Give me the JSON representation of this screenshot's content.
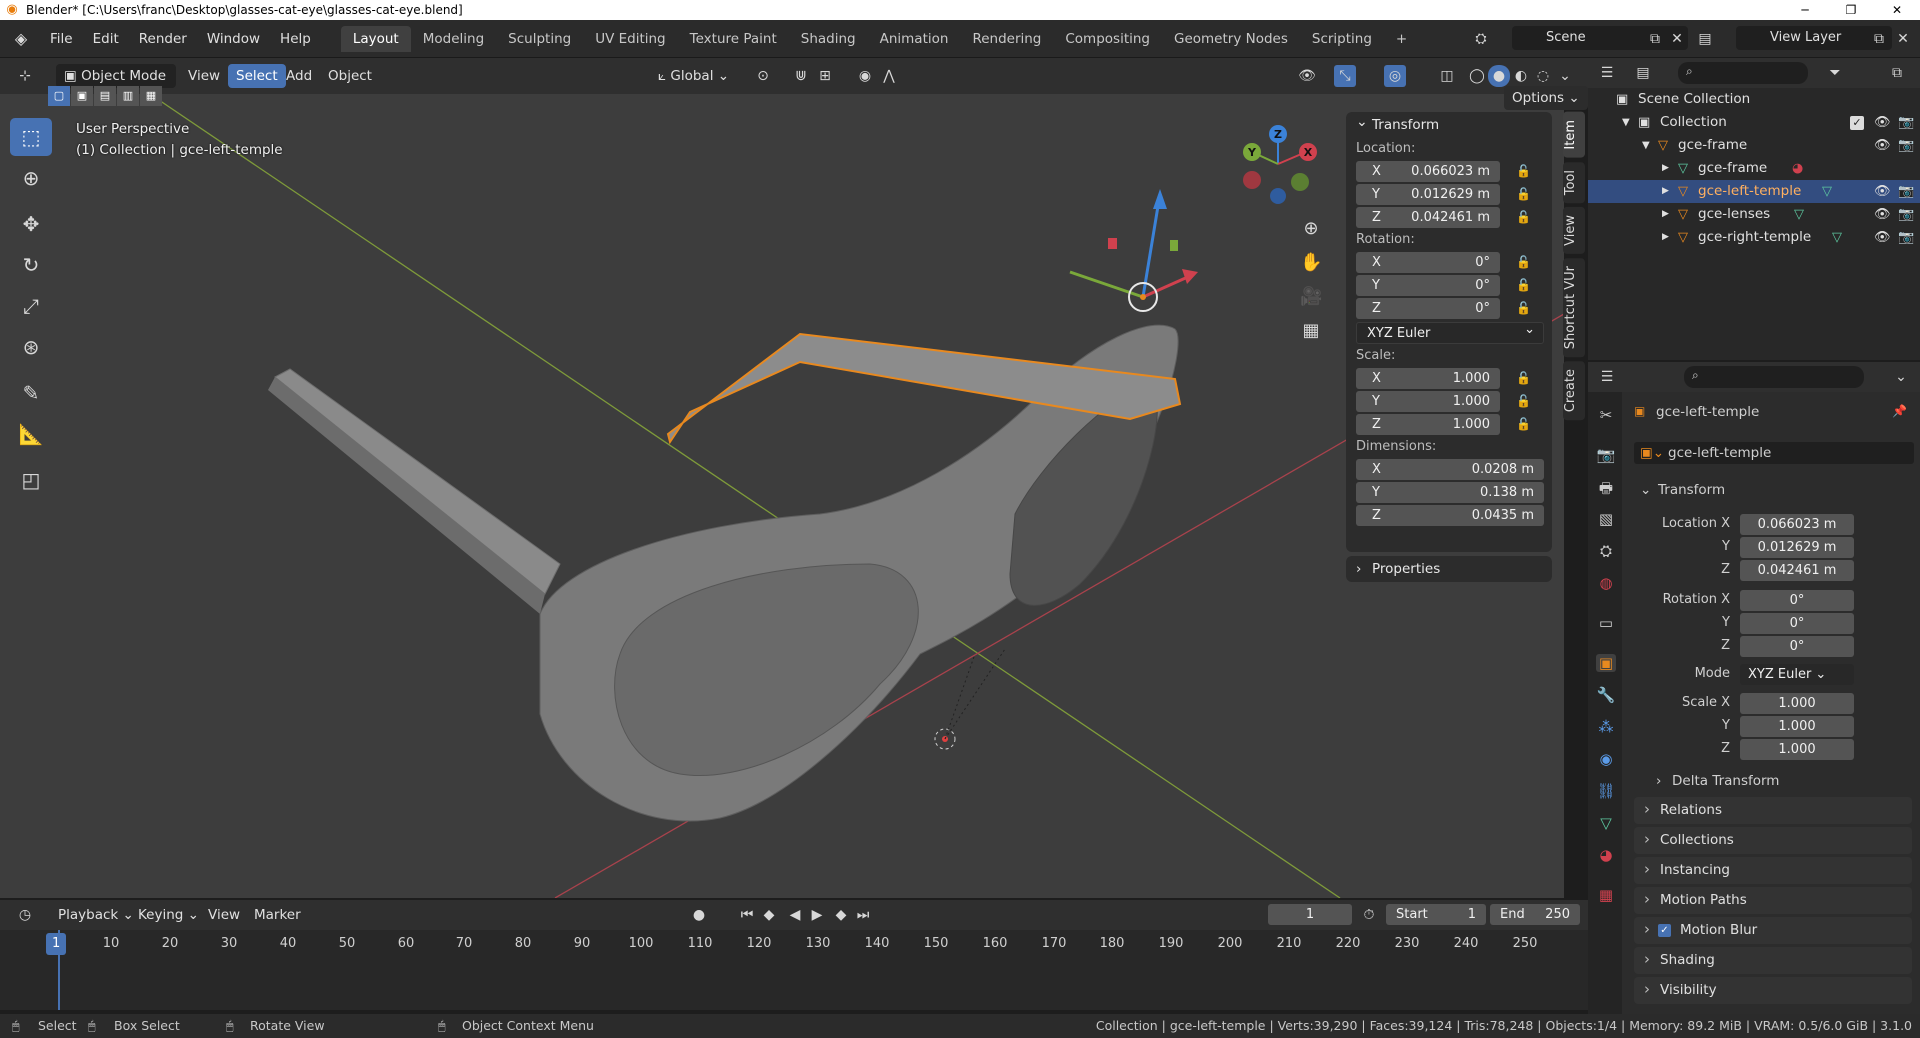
{
  "title": "Blender* [C:\\Users\\franc\\Desktop\\glasses-cat-eye\\glasses-cat-eye.blend]",
  "menu": [
    "File",
    "Edit",
    "Render",
    "Window",
    "Help"
  ],
  "workspaces": [
    "Layout",
    "Modeling",
    "Sculpting",
    "UV Editing",
    "Texture Paint",
    "Shading",
    "Animation",
    "Rendering",
    "Compositing",
    "Geometry Nodes",
    "Scripting"
  ],
  "active_workspace": "Layout",
  "scene": "Scene",
  "view_layer": "View Layer",
  "viewport_header": {
    "mode": "Object Mode",
    "view": "View",
    "select": "Select",
    "add": "Add",
    "object": "Object",
    "orientation": "Global",
    "options": "Options"
  },
  "viewport_info": {
    "perspective": "User Perspective",
    "collection": "(1) Collection | gce-left-temple"
  },
  "gizmo_axes": {
    "x": "X",
    "y": "Y",
    "z": "Z"
  },
  "npanel": {
    "header": "Transform",
    "location_label": "Location:",
    "location": [
      {
        "axis": "X",
        "value": "0.066023 m"
      },
      {
        "axis": "Y",
        "value": "0.012629 m"
      },
      {
        "axis": "Z",
        "value": "0.042461 m"
      }
    ],
    "rotation_label": "Rotation:",
    "rotation": [
      {
        "axis": "X",
        "value": "0°"
      },
      {
        "axis": "Y",
        "value": "0°"
      },
      {
        "axis": "Z",
        "value": "0°"
      }
    ],
    "rotation_mode": "XYZ Euler",
    "scale_label": "Scale:",
    "scale": [
      {
        "axis": "X",
        "value": "1.000"
      },
      {
        "axis": "Y",
        "value": "1.000"
      },
      {
        "axis": "Z",
        "value": "1.000"
      }
    ],
    "dimensions_label": "Dimensions:",
    "dimensions": [
      {
        "axis": "X",
        "value": "0.0208 m"
      },
      {
        "axis": "Y",
        "value": "0.138 m"
      },
      {
        "axis": "Z",
        "value": "0.0435 m"
      }
    ],
    "properties": "Properties"
  },
  "side_tabs": [
    "Item",
    "Tool",
    "View",
    "Shortcut VUr",
    "Create"
  ],
  "timeline": {
    "menus": [
      "Playback",
      "Keying",
      "View",
      "Marker"
    ],
    "current_frame": "1",
    "start_label": "Start",
    "start": "1",
    "end_label": "End",
    "end": "250",
    "ticks": [
      "1",
      "10",
      "20",
      "30",
      "40",
      "50",
      "60",
      "70",
      "80",
      "90",
      "100",
      "110",
      "120",
      "130",
      "140",
      "150",
      "160",
      "170",
      "180",
      "190",
      "200",
      "210",
      "220",
      "230",
      "240",
      "250"
    ]
  },
  "status": {
    "select": "Select",
    "box_select": "Box Select",
    "rotate_view": "Rotate View",
    "context_menu": "Object Context Menu",
    "stats": "Collection | gce-left-temple | Verts:39,290 | Faces:39,124 | Tris:78,248 | Objects:1/4 | Memory: 89.2 MiB | VRAM: 0.5/6.0 GiB | 3.1.0"
  },
  "outliner": {
    "scene_collection": "Scene Collection",
    "collection": "Collection",
    "items": [
      {
        "name": "gce-frame",
        "level": 0
      },
      {
        "name": "gce-frame",
        "level": 1
      },
      {
        "name": "gce-left-temple",
        "level": 1,
        "selected": true
      },
      {
        "name": "gce-lenses",
        "level": 1
      },
      {
        "name": "gce-right-temple",
        "level": 1
      }
    ]
  },
  "properties": {
    "object_name": "gce-left-temple",
    "object_field": "gce-left-temple",
    "transform_header": "Transform",
    "location_x_label": "Location X",
    "location": [
      "0.066023 m",
      "0.012629 m",
      "0.042461 m"
    ],
    "rotation_x_label": "Rotation X",
    "rotation": [
      "0°",
      "0°",
      "0°"
    ],
    "mode_label": "Mode",
    "mode": "XYZ Euler",
    "scale_x_label": "Scale X",
    "scale": [
      "1.000",
      "1.000",
      "1.000"
    ],
    "y_label": "Y",
    "z_label": "Z",
    "delta_transform": "Delta Transform",
    "sections": [
      "Relations",
      "Collections",
      "Instancing",
      "Motion Paths",
      "Motion Blur",
      "Shading",
      "Visibility"
    ]
  },
  "colors": {
    "accent": "#4772b3",
    "selection_outline": "#e8891f",
    "axis_x": "#d0414e",
    "axis_y": "#7aa83a",
    "axis_z": "#3b82d8"
  }
}
